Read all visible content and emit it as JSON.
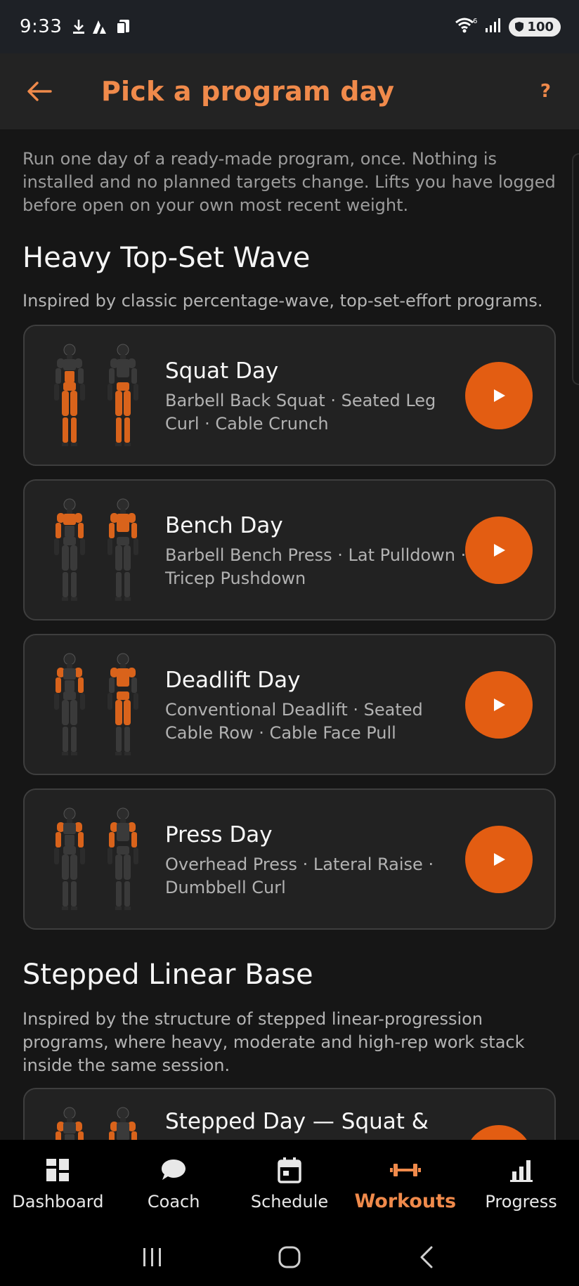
{
  "status_bar": {
    "time": "9:33",
    "battery": "100",
    "signal_badge": "6"
  },
  "header": {
    "title": "Pick a program day",
    "help_label": "?"
  },
  "intro": "Run one day of a ready-made program, once. Nothing is installed and no planned targets change. Lifts you have logged before open on your own most recent weight.",
  "sections": [
    {
      "title": "Heavy Top-Set Wave",
      "description": "Inspired by classic percentage-wave, top-set-effort programs.",
      "days": [
        {
          "title": "Squat Day",
          "exercises": "Barbell Back Squat · Seated Leg Curl · Cable Crunch"
        },
        {
          "title": "Bench Day",
          "exercises": "Barbell Bench Press · Lat Pulldown · Tricep Pushdown"
        },
        {
          "title": "Deadlift Day",
          "exercises": "Conventional Deadlift · Seated Cable Row · Cable Face Pull"
        },
        {
          "title": "Press Day",
          "exercises": "Overhead Press · Lateral Raise · Dumbbell Curl"
        }
      ]
    },
    {
      "title": "Stepped Linear Base",
      "description": "Inspired by the structure of stepped linear-progression programs, where heavy, moderate and high-rep work stack inside the same session.",
      "days": [
        {
          "title": "Stepped Day — Squat &",
          "exercises": ""
        }
      ]
    }
  ],
  "nav": [
    {
      "label": "Dashboard",
      "icon": "dashboard-icon"
    },
    {
      "label": "Coach",
      "icon": "chat-bubble-icon"
    },
    {
      "label": "Schedule",
      "icon": "calendar-icon"
    },
    {
      "label": "Workouts",
      "icon": "dumbbell-icon",
      "active": true
    },
    {
      "label": "Progress",
      "icon": "bar-chart-icon"
    }
  ],
  "colors": {
    "accent": "#f08a4b",
    "play_button": "#e35d12",
    "muscle_highlight": "#d9631b",
    "background": "#161616",
    "card": "#222222"
  }
}
